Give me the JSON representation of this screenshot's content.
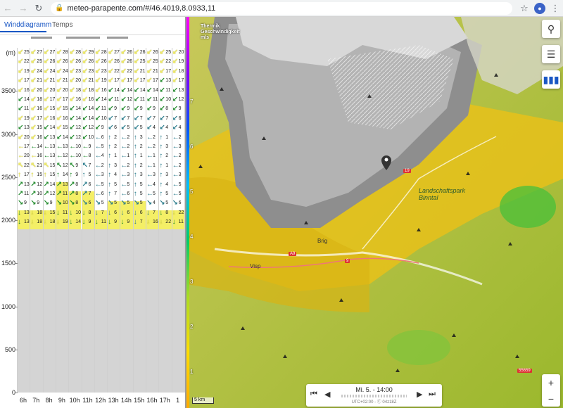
{
  "browser": {
    "back_icon": "arrow-left-icon",
    "forward_icon": "arrow-right-icon",
    "reload_icon": "reload-icon",
    "url": "meteo-parapente.com/#/46.4019,8.0933,11"
  },
  "tabs": {
    "wind": "Winddiagramm",
    "temps": "Temps"
  },
  "diagram": {
    "y_unit": "(m)",
    "y_ticks": [
      "3500",
      "3000",
      "2500",
      "2000",
      "1500",
      "1000",
      "500",
      "0"
    ],
    "hours": [
      "6h",
      "7h",
      "8h",
      "9h",
      "10h",
      "11h",
      "12h",
      "13h",
      "14h",
      "15h",
      "16h",
      "17h",
      "1"
    ],
    "colors": {
      "wind_yellow": "#f4ef66",
      "wind_green": "#1f8a2a",
      "wind_teal": "#2a7c8c",
      "empty": "#d4d4d4"
    },
    "rows": [
      [
        "25",
        "27",
        "27",
        "28",
        "28",
        "29",
        "28",
        "27",
        "26",
        "26",
        "26",
        "25",
        "20"
      ],
      [
        "22",
        "25",
        "26",
        "26",
        "26",
        "26",
        "26",
        "26",
        "26",
        "25",
        "25",
        "22",
        "19"
      ],
      [
        "19",
        "24",
        "24",
        "24",
        "23",
        "23",
        "23",
        "22",
        "22",
        "21",
        "21",
        "17",
        "18"
      ],
      [
        "17",
        "21",
        "21",
        "21",
        "20",
        "21",
        "19",
        "17",
        "17",
        "17",
        "17",
        "13",
        "17"
      ],
      [
        "16",
        "20",
        "20",
        "20",
        "18",
        "18",
        "16",
        "14",
        "14",
        "14",
        "14",
        "11",
        "13"
      ],
      [
        "14",
        "18",
        "17",
        "17",
        "16",
        "16",
        "14",
        "11",
        "12",
        "11",
        "11",
        "10",
        "12"
      ],
      [
        "11",
        "16",
        "15",
        "15",
        "14",
        "14",
        "11",
        "9",
        "9",
        "9",
        "9",
        "8",
        "9"
      ],
      [
        "19",
        "17",
        "16",
        "16",
        "14",
        "14",
        "10",
        "7",
        "7",
        "7",
        "7",
        "7",
        "6"
      ],
      [
        "13",
        "15",
        "14",
        "15",
        "12",
        "12",
        "9",
        "6",
        "5",
        "5",
        "4",
        "4",
        "4"
      ],
      [
        "20",
        "16",
        "13",
        "14",
        "12",
        "10",
        "6",
        "2",
        "2",
        "3",
        "2",
        "1",
        "2"
      ],
      [
        "17",
        "14",
        "13",
        "13",
        "10",
        "9",
        "5",
        "2",
        "2",
        "2",
        "2",
        "3",
        "3"
      ],
      [
        "20",
        "16",
        "13",
        "12",
        "10",
        "8",
        "4",
        "1",
        "1",
        "1",
        "1",
        "2",
        "2"
      ],
      [
        "22",
        "21",
        "15",
        "12",
        "9",
        "7",
        "2",
        "3",
        "2",
        "2",
        "1",
        "1",
        "2"
      ],
      [
        "17",
        "15",
        "15",
        "14",
        "9",
        "5",
        "3",
        "4",
        "3",
        "3",
        "3",
        "3",
        "3"
      ],
      [
        "13",
        "12",
        "14",
        "13",
        "8",
        "6",
        "5",
        "5",
        "5",
        "5",
        "4",
        "4",
        "5"
      ],
      [
        "11",
        "10",
        "12",
        "11",
        "8",
        "7",
        "6",
        "7",
        "6",
        "5",
        "5",
        "5",
        "5"
      ],
      [
        "9",
        "9",
        "9",
        "10",
        "8",
        "6",
        "5",
        "5",
        "5",
        "5",
        "4",
        "5",
        "6"
      ],
      [
        "13",
        "18",
        "15",
        "11",
        "10",
        "8",
        "7",
        "6",
        "6",
        "6",
        "7",
        "8",
        "22"
      ],
      [
        "13",
        "18",
        "18",
        "19",
        "14",
        "9",
        "11",
        "9",
        "9",
        "7",
        "16",
        "22",
        "11"
      ]
    ]
  },
  "map": {
    "legend_title": "Thermik Geschwindigkeit m/s",
    "legend_ticks": [
      "7",
      "6",
      "5",
      "4",
      "3",
      "2",
      "1",
      "0"
    ],
    "legend_colors": [
      "#ff00ff",
      "#8800ff",
      "#0055ff",
      "#00bfff",
      "#00cc66",
      "#aadd22",
      "#ffdd00",
      "#ffaa00"
    ],
    "places": [
      "Brig",
      "Visp",
      "Landschaftspark Binntal"
    ],
    "road_labels": [
      "A9",
      "19",
      "9",
      "55659"
    ],
    "scale": "5 km",
    "buttons": {
      "search": "search-icon",
      "settings": "sliders-icon",
      "chart": "bar-chart-icon"
    },
    "zoom_in": "+",
    "zoom_out": "−",
    "time": {
      "label": "Mi. 5. - 14:00",
      "tz": "UTC+02:00 - Ⓒ 04z18Z"
    }
  }
}
